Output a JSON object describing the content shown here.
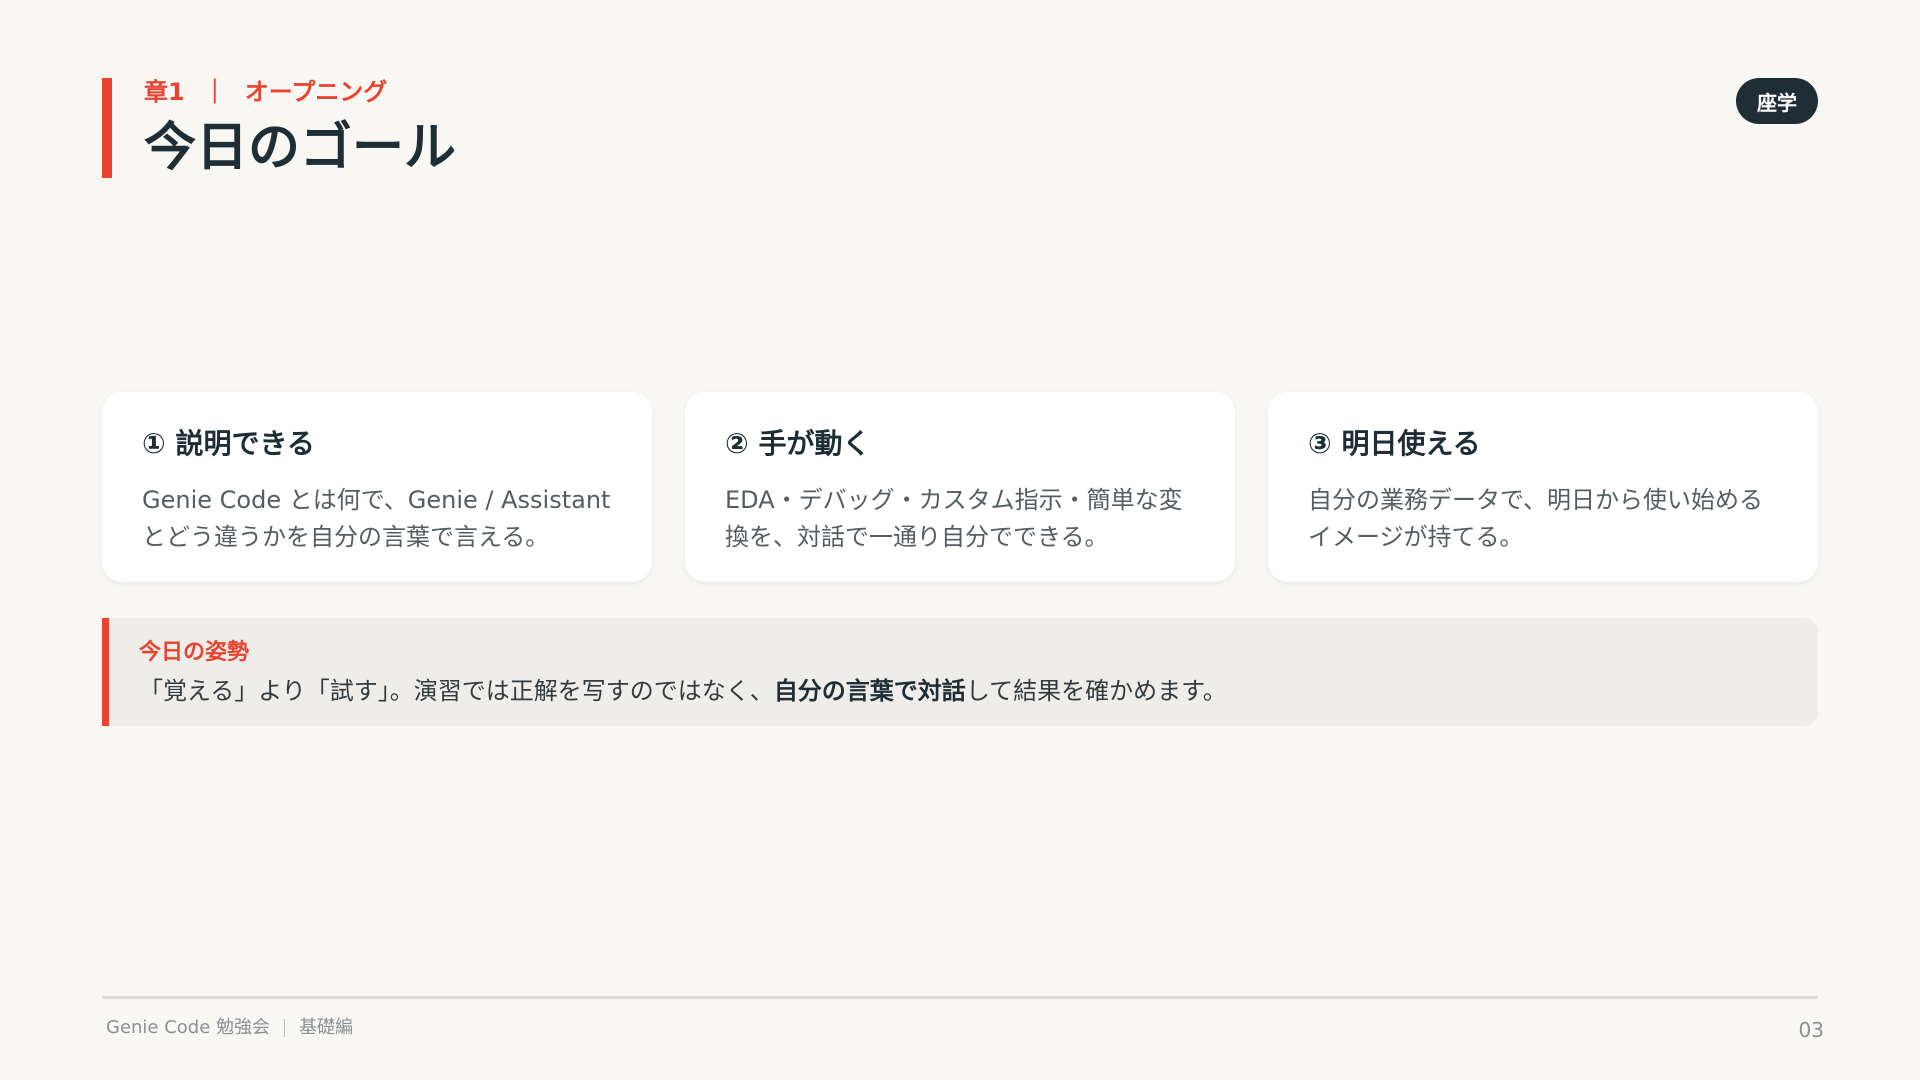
{
  "header": {
    "chapter": "章1",
    "separator": "｜",
    "section": "オープニング",
    "title": "今日のゴール"
  },
  "badge": "座学",
  "cards": [
    {
      "title": "① 説明できる",
      "body": "Genie Code とは何で、Genie / Assistant とどう違うかを自分の言葉で言える。"
    },
    {
      "title": "② 手が動く",
      "body": "EDA・デバッグ・カスタム指示・簡単な変換を、対話で一通り自分でできる。"
    },
    {
      "title": "③ 明日使える",
      "body": "自分の業務データで、明日から使い始めるイメージが持てる。"
    }
  ],
  "stance": {
    "label": "今日の姿勢",
    "text_before": "「覚える」より「試す」。演習では正解を写すのではなく、",
    "text_bold": "自分の言葉で対話",
    "text_after": "して結果を確かめます。"
  },
  "footer": {
    "course": "Genie Code 勉強会",
    "edition": "基礎編",
    "page": "03"
  },
  "colors": {
    "accent": "#e8432f",
    "dark": "#1f2d34",
    "background": "#f8f7f4"
  }
}
